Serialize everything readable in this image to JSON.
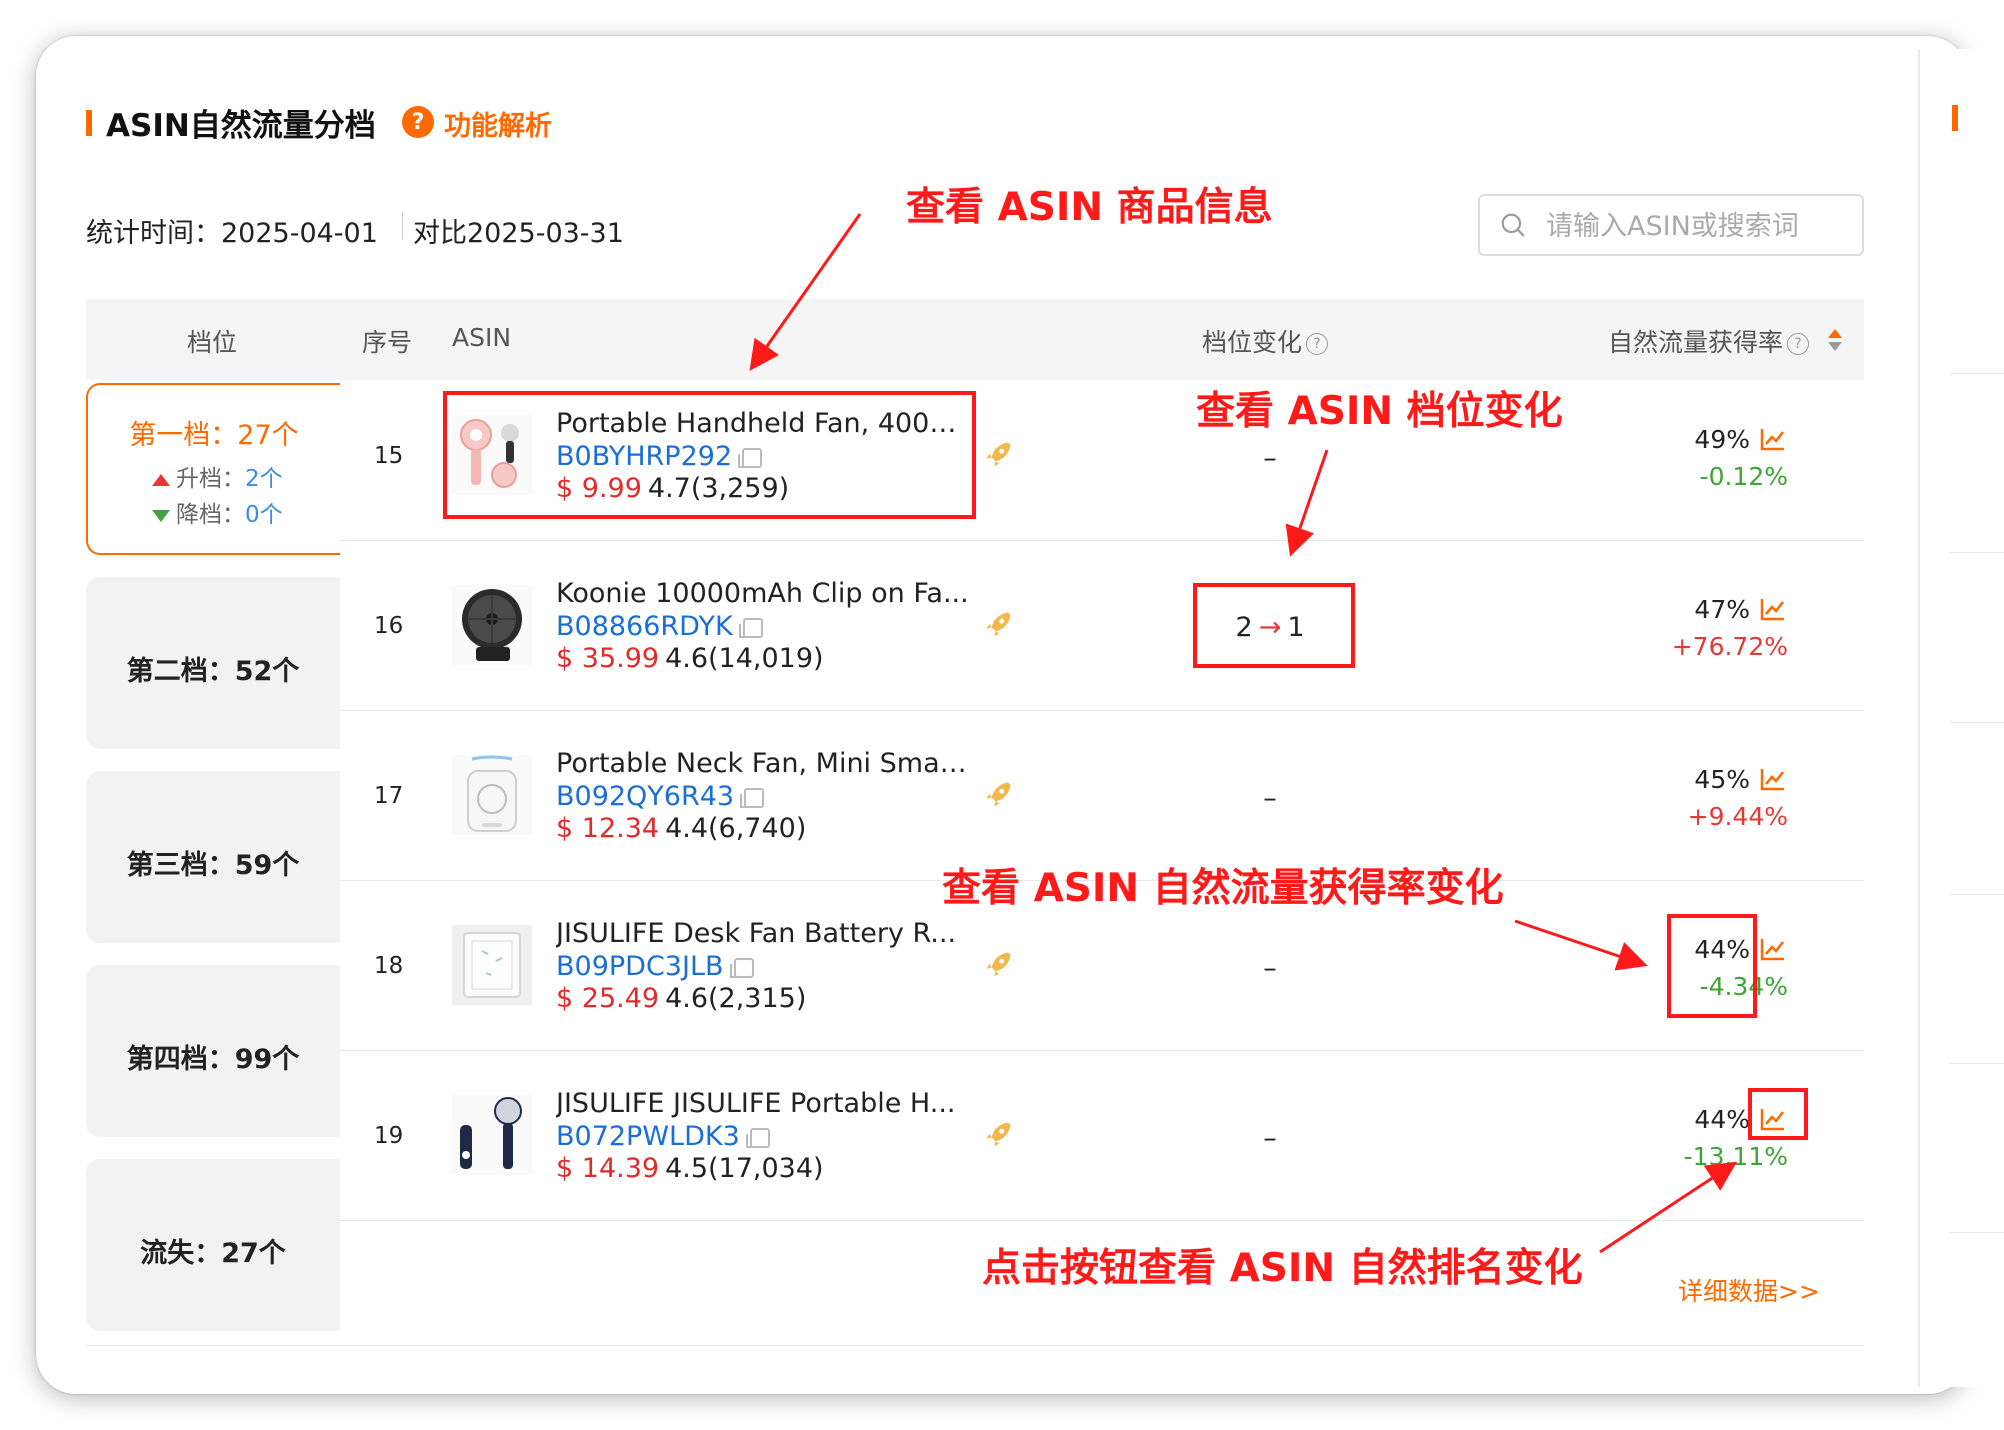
{
  "header": {
    "title": "ASIN自然流量分档",
    "help_label": "功能解析",
    "stat_time": "统计时间：2025-04-01",
    "compare": "对比2025-03-31"
  },
  "search": {
    "placeholder": "请输入ASIN或搜索词"
  },
  "columns": {
    "tier": "档位",
    "rank": "序号",
    "asin": "ASIN",
    "tier_change": "档位变化",
    "traffic_rate": "自然流量获得率"
  },
  "tiers": [
    {
      "label": "第一档：27个",
      "up_label": "升档：",
      "up_count": "2个",
      "down_label": "降档：",
      "down_count": "0个",
      "active": true
    },
    {
      "label": "第二档：52个"
    },
    {
      "label": "第三档：59个"
    },
    {
      "label": "第四档：99个"
    },
    {
      "label": "流失：27个"
    }
  ],
  "rows": [
    {
      "rank": "15",
      "title": "Portable Handheld Fan, 4000...",
      "asin": "B0BYHRP292",
      "price": "$ 9.99",
      "rating": "4.7(3,259)",
      "tier_change": "–",
      "rate": "49%",
      "delta": "-0.12%",
      "delta_dir": "neg"
    },
    {
      "rank": "16",
      "title": "Koonie 10000mAh Clip on Fa...",
      "asin": "B08866RDYK",
      "price": "$ 35.99",
      "rating": "4.6(14,019)",
      "tier_from": "2",
      "tier_arrow": "→",
      "tier_to": "1",
      "rate": "47%",
      "delta": "+76.72%",
      "delta_dir": "pos"
    },
    {
      "rank": "17",
      "title": "Portable Neck Fan, Mini Smal...",
      "asin": "B092QY6R43",
      "price": "$ 12.34",
      "rating": "4.4(6,740)",
      "tier_change": "–",
      "rate": "45%",
      "delta": "+9.44%",
      "delta_dir": "pos"
    },
    {
      "rank": "18",
      "title": "JISULIFE Desk Fan Battery R...",
      "asin": "B09PDC3JLB",
      "price": "$ 25.49",
      "rating": "4.6(2,315)",
      "tier_change": "–",
      "rate": "44%",
      "delta": "-4.34%",
      "delta_dir": "neg"
    },
    {
      "rank": "19",
      "title": "JISULIFE JISULIFE Portable H...",
      "asin": "B072PWLDK3",
      "price": "$ 14.39",
      "rating": "4.5(17,034)",
      "tier_change": "–",
      "rate": "44%",
      "delta": "-13.11%",
      "delta_dir": "neg"
    }
  ],
  "detail_link": "详细数据>>",
  "annotations": {
    "product_info": "查看 ASIN 商品信息",
    "tier_change": "查看 ASIN 档位变化",
    "rate_change": "查看 ASIN 自然流量获得率变化",
    "rank_button": "点击按钮查看 ASIN 自然排名变化"
  },
  "colors": {
    "accent": "#ff6a00",
    "link": "#1a6fd6",
    "price": "#e02b2b",
    "positive": "#e53935",
    "negative": "#3da535",
    "annotation": "#ff1a1a"
  },
  "icons": {
    "help": "question-circle-icon",
    "search": "search-icon",
    "copy": "copy-icon",
    "rocket": "rocket-icon",
    "trend": "line-chart-icon",
    "sort": "sort-icon"
  }
}
